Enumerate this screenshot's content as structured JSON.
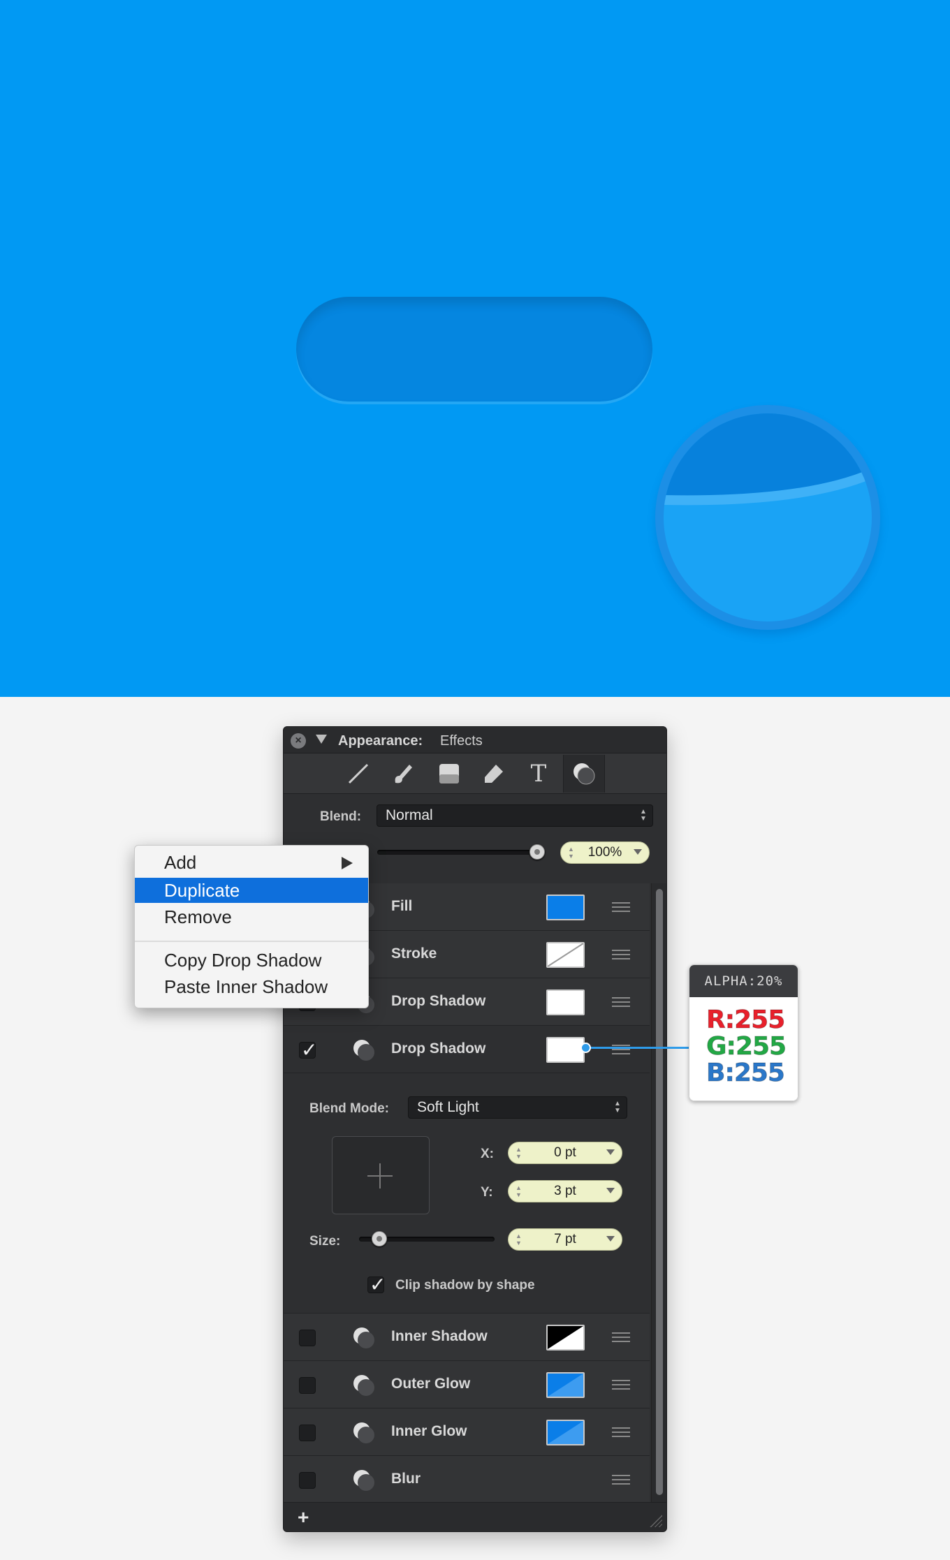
{
  "panel": {
    "title_label": "Appearance:",
    "title_value": "Effects",
    "toolbar": [
      {
        "icon": "line-tool-icon"
      },
      {
        "icon": "brush-tool-icon"
      },
      {
        "icon": "fill-tool-icon"
      },
      {
        "icon": "eraser-tool-icon"
      },
      {
        "icon": "text-tool-icon",
        "glyph": "T"
      },
      {
        "icon": "effects-tool-icon",
        "active": true
      }
    ],
    "blend_label": "Blend:",
    "blend_value": "Normal",
    "opacity_value": "100%",
    "opacity_fraction": 1.0,
    "effects": [
      {
        "name": "Fill",
        "checked": false,
        "swatch": "blue"
      },
      {
        "name": "Stroke",
        "checked": true,
        "swatch": "none"
      },
      {
        "name": "Drop Shadow",
        "checked": true,
        "swatch": "white"
      },
      {
        "name": "Drop Shadow",
        "checked": true,
        "swatch": "white"
      }
    ],
    "details": {
      "blend_mode_label": "Blend Mode:",
      "blend_mode_value": "Soft Light",
      "x_label": "X:",
      "x_value": "0 pt",
      "y_label": "Y:",
      "y_value": "3 pt",
      "size_label": "Size:",
      "size_value": "7 pt",
      "size_fraction": 0.1,
      "clip_label": "Clip shadow by shape",
      "clip_checked": true
    },
    "effects_more": [
      {
        "name": "Inner Shadow",
        "checked": false,
        "swatch": "black"
      },
      {
        "name": "Outer Glow",
        "checked": false,
        "swatch": "blue"
      },
      {
        "name": "Inner Glow",
        "checked": false,
        "swatch": "blue"
      },
      {
        "name": "Blur",
        "checked": false
      }
    ],
    "add_label": "+"
  },
  "menu": {
    "items": [
      "Add",
      "Duplicate",
      "Remove",
      "Copy Drop Shadow",
      "Paste Inner Shadow"
    ],
    "selected": "Duplicate"
  },
  "callout": {
    "alpha": "ALPHA:20%",
    "r": "R:255",
    "g": "G:255",
    "b": "B:255"
  },
  "colors": {
    "canvas": "#0199f3",
    "shape": "#0586e0",
    "swatch_blue": "#0a7ee8",
    "r": "#e8202b",
    "g": "#22a845",
    "b": "#2a77c9"
  }
}
